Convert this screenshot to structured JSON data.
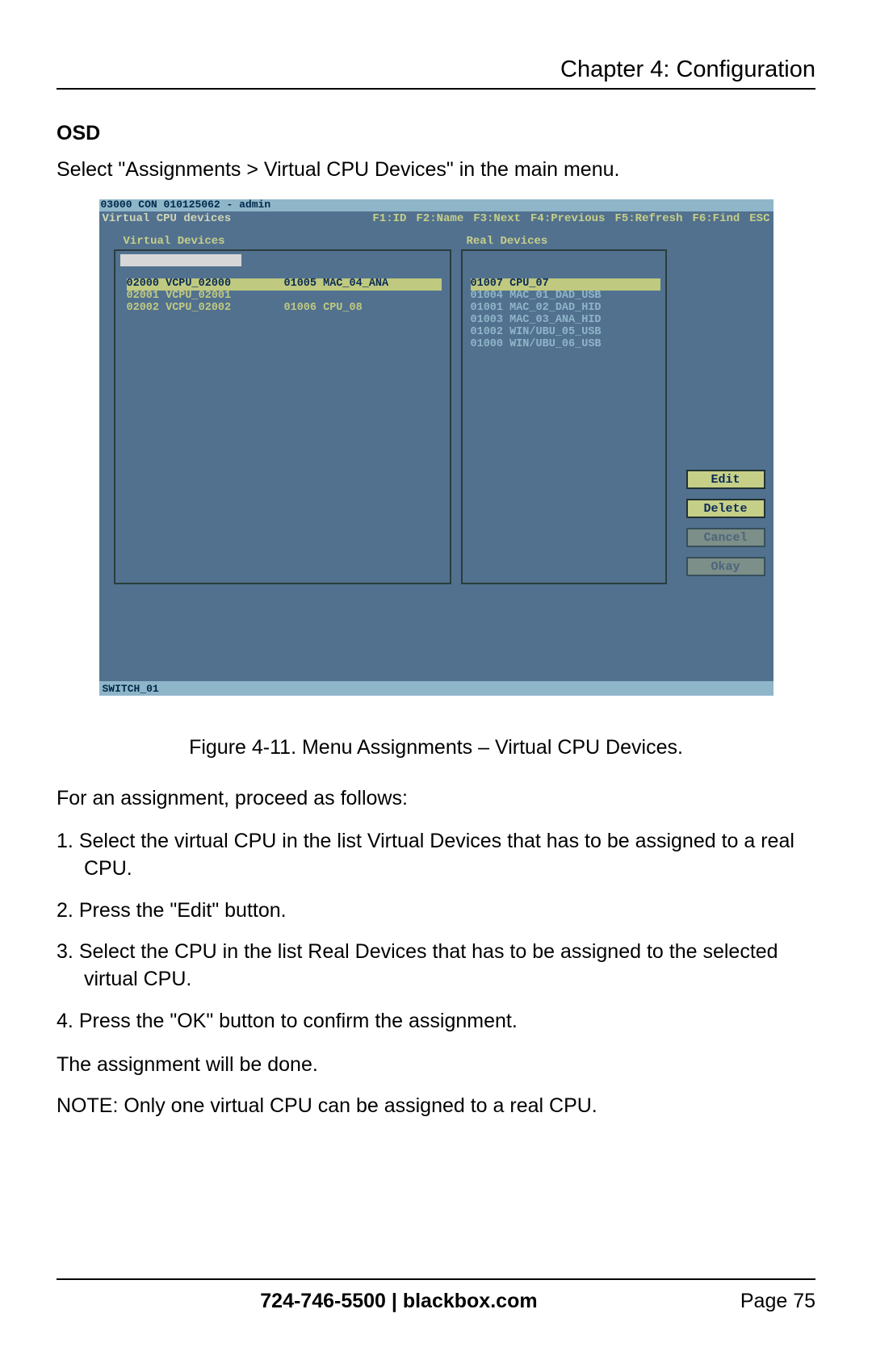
{
  "chapter": "Chapter 4: Configuration",
  "osd_heading": "OSD",
  "intro": "Select \"Assignments > Virtual CPU Devices\" in the main menu.",
  "caption": "Figure 4-11. Menu Assignments – Virtual CPU Devices.",
  "lead": "For an assignment, proceed as follows:",
  "steps": [
    "Select the virtual CPU in the list Virtual Devices that has to be assigned to a real CPU.",
    "Press the \"Edit\" button.",
    "Select the CPU in the list Real Devices that has to be assigned to the selected virtual CPU.",
    "Press the \"OK\" button to confirm the assignment."
  ],
  "after": "The assignment will be done.",
  "note": "NOTE: Only one virtual CPU can be assigned to a real CPU.",
  "footer": {
    "phone_site": "724-746-5500   |   blackbox.com",
    "page": "Page 75"
  },
  "osd": {
    "titlebar": "03000 CON 010125062 - admin",
    "menu_title": "Virtual CPU devices",
    "fkeys": {
      "f1": "F1:ID",
      "f2": "F2:Name",
      "f3": "F3:Next",
      "f4": "F4:Previous",
      "f5": "F5:Refresh",
      "f6": "F6:Find",
      "esc": "ESC"
    },
    "panels": {
      "virtual_label": "Virtual Devices",
      "real_label": "Real Devices"
    },
    "virtual_rows": [
      {
        "c1": "02000 VCPU_02000",
        "c2": "01005 MAC_04_ANA",
        "sel": true
      },
      {
        "c1": "02001 VCPU_02001",
        "c2": "",
        "sel": false
      },
      {
        "c1": "02002 VCPU_02002",
        "c2": "01006 CPU_08",
        "sel": false
      }
    ],
    "real_rows": [
      {
        "t": "01007 CPU_07",
        "sel": true,
        "dim": false
      },
      {
        "t": "01004 MAC_01_DAD_USB",
        "sel": false,
        "dim": true
      },
      {
        "t": "01001 MAC_02_DAD_HID",
        "sel": false,
        "dim": true
      },
      {
        "t": "01003 MAC_03_ANA_HID",
        "sel": false,
        "dim": true
      },
      {
        "t": "01002 WIN/UBU_05_USB",
        "sel": false,
        "dim": true
      },
      {
        "t": "01000 WIN/UBU_06_USB",
        "sel": false,
        "dim": true
      }
    ],
    "buttons": {
      "edit": "Edit",
      "delete": "Delete",
      "cancel": "Cancel",
      "okay": "Okay"
    },
    "status": "SWITCH_01"
  }
}
